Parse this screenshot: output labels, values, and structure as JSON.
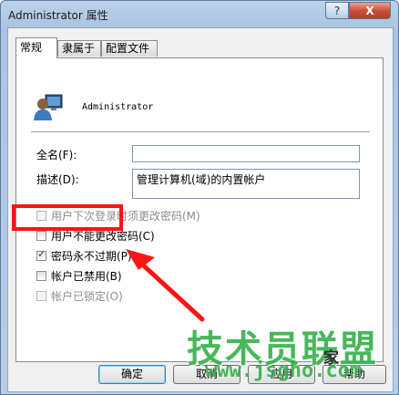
{
  "window": {
    "title": "Administrator 属性",
    "help_label": "?",
    "close_label": "X"
  },
  "tabs": [
    {
      "label": "常规",
      "active": true
    },
    {
      "label": "隶属于",
      "active": false
    },
    {
      "label": "配置文件",
      "active": false
    }
  ],
  "general": {
    "username": "Administrator",
    "fullname_label": "全名(F):",
    "fullname_value": "",
    "description_label": "描述(D):",
    "description_value": "管理计算机(域)的内置帐户"
  },
  "checkboxes": [
    {
      "label": "用户下次登录时须更改密码(M)",
      "checked": false,
      "enabled": false
    },
    {
      "label": "用户不能更改密码(C)",
      "checked": false,
      "enabled": true
    },
    {
      "label": "密码永不过期(P)",
      "checked": true,
      "enabled": true
    },
    {
      "label": "帐户已禁用(B)",
      "checked": false,
      "enabled": true
    },
    {
      "label": "帐户已锁定(O)",
      "checked": false,
      "enabled": false
    }
  ],
  "buttons": {
    "ok": "确定",
    "cancel": "取消",
    "apply": "应用",
    "help": "帮助"
  },
  "watermark": {
    "main": "技术员联盟",
    "url": "www.jsgho.com",
    "extra": "家"
  },
  "colors": {
    "highlight": "#ff1414",
    "watermark": "#37b24d"
  }
}
